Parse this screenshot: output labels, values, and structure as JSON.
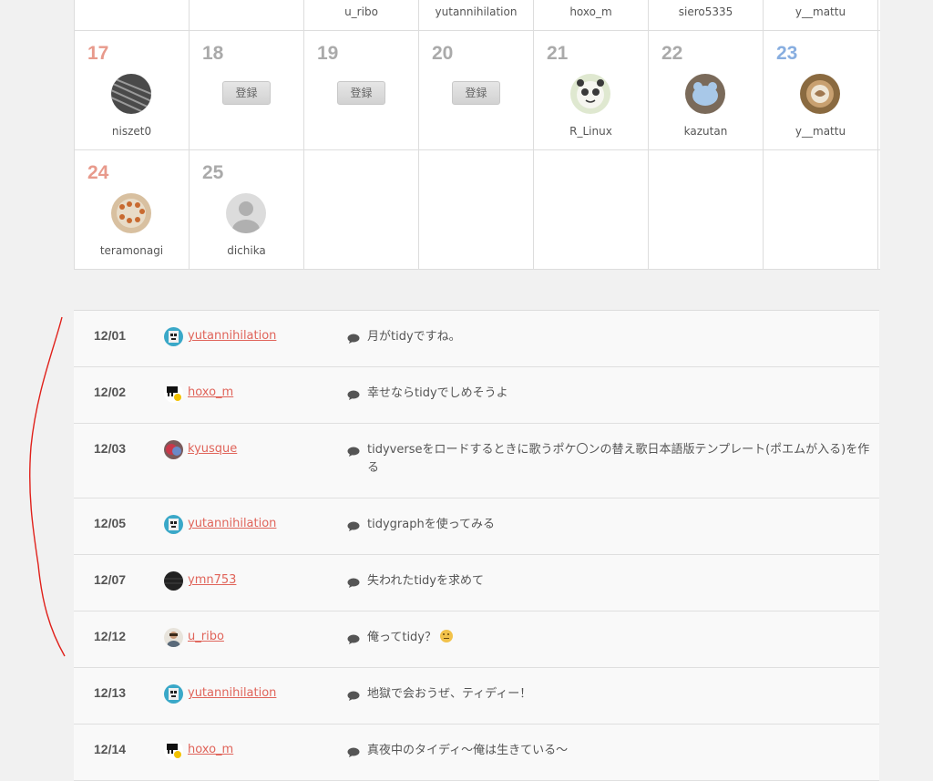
{
  "calendar": {
    "week_partial": [
      "",
      "",
      "u_ribo",
      "yutannihilation",
      "hoxo_m",
      "siero5335",
      "y__mattu"
    ],
    "week3": [
      {
        "day": "17",
        "user": "niszet0"
      },
      {
        "day": "18",
        "button": "登録"
      },
      {
        "day": "19",
        "button": "登録"
      },
      {
        "day": "20",
        "button": "登録"
      },
      {
        "day": "21",
        "user": "R_Linux"
      },
      {
        "day": "22",
        "user": "kazutan"
      },
      {
        "day": "23",
        "user": "y__mattu"
      }
    ],
    "week4": [
      {
        "day": "24",
        "user": "teramonagi"
      },
      {
        "day": "25",
        "user": "dichika"
      }
    ]
  },
  "entries": [
    {
      "date": "12/01",
      "user": "yutannihilation",
      "title": "月がtidyですね。"
    },
    {
      "date": "12/02",
      "user": "hoxo_m",
      "title": "幸せならtidyでしめそうよ"
    },
    {
      "date": "12/03",
      "user": "kyusque",
      "title": "tidyverseをロードするときに歌うポケ〇ンの替え歌日本語版テンプレート(ポエムが入る)を作る"
    },
    {
      "date": "12/05",
      "user": "yutannihilation",
      "title": "tidygraphを使ってみる"
    },
    {
      "date": "12/07",
      "user": "ymn753",
      "title": "失われたtidyを求めて"
    },
    {
      "date": "12/12",
      "user": "u_ribo",
      "title": "俺ってtidy？"
    },
    {
      "date": "12/13",
      "user": "yutannihilation",
      "title": "地獄で会おうぜ、ティディー！"
    },
    {
      "date": "12/14",
      "user": "hoxo_m",
      "title": "真夜中のタイディ〜俺は生きている〜"
    }
  ],
  "colors": {
    "sunday": "#e89a8c",
    "saturday": "#88aee0",
    "link": "#e0645a",
    "annotation": "#e0201a"
  }
}
